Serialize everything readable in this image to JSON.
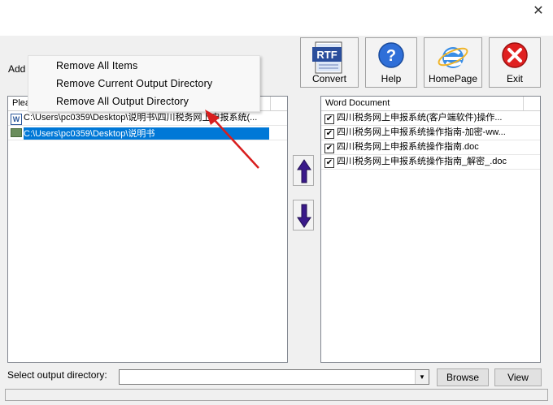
{
  "window": {
    "close_glyph": "✕"
  },
  "toolbar": {
    "add_label": "Add",
    "convert_label": "Convert",
    "rtf_text": "RTF",
    "help_label": "Help",
    "homepage_label": "HomePage",
    "exit_label": "Exit"
  },
  "context_menu": {
    "items": [
      "Remove All Items",
      "Remove Current Output Directory",
      "Remove All Output Directory"
    ]
  },
  "left_panel": {
    "header": "Plea",
    "rows": [
      "C:\\Users\\pc0359\\Desktop\\说明书\\四川税务网上申报系统(...",
      "C:\\Users\\pc0359\\Desktop\\说明书"
    ]
  },
  "right_panel": {
    "header": "Word Document",
    "rows": [
      "四川税务网上申报系统(客户端软件)操作...",
      "四川税务网上申报系统操作指南-加密-ww...",
      "四川税务网上申报系统操作指南.doc",
      "四川税务网上申报系统操作指南_解密_.doc"
    ]
  },
  "bottom": {
    "output_label": "Select  output directory:",
    "output_value": "",
    "browse_label": "Browse",
    "view_label": "View"
  }
}
